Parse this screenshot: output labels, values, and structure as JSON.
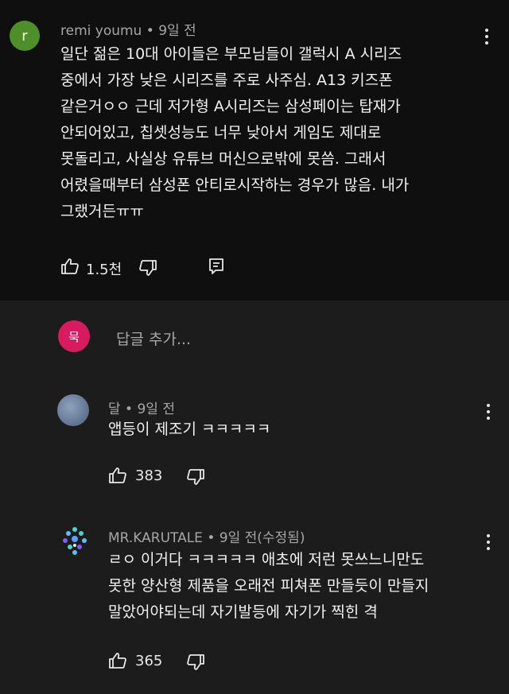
{
  "top_comment": {
    "avatar_letter": "r",
    "author": "remi youmu",
    "time": "9일 전",
    "text": "일단 젊은 10대 아이들은 부모님들이 갤럭시 A 시리즈\n중에서 가장 낮은 시리즈를 주로 사주심. A13 키즈폰\n같은거ㅇㅇ 근데 저가형 A시리즈는 삼성페이는 탑재가\n안되어있고, 칩셋성능도 너무 낮아서 게임도 제대로\n못돌리고, 사실상 유튜브 머신으로밖에 못씀. 그래서\n어렸을때부터 삼성폰 안티로시작하는 경우가 많음. 내가\n그랬거든ㅠㅠ",
    "likes": "1.5천"
  },
  "reply_input": {
    "avatar_letter": "묵",
    "placeholder": "답글 추가..."
  },
  "replies": [
    {
      "author": "달",
      "time": "9일 전",
      "text": "앱등이 제조기 ㅋㅋㅋㅋㅋ",
      "likes": "383"
    },
    {
      "author": "MR.KARUTALE",
      "time": "9일 전(수정됨)",
      "text": "ㄹㅇ 이거다 ㅋㅋㅋㅋㅋ 애초에 저런 못쓰느니만도\n못한 양산형 제품을 오래전 피쳐폰 만들듯이 만들지\n말았어야되는데 자기발등에 자기가 찍힌 격",
      "likes": "365"
    }
  ],
  "colors": {
    "top_bg": "#0f0f0f",
    "reply_bg": "#1c1c1c",
    "avatar_r": "#4e8f2a",
    "avatar_input": "#d81b60",
    "avatar_dal": "#5b6f8c"
  }
}
